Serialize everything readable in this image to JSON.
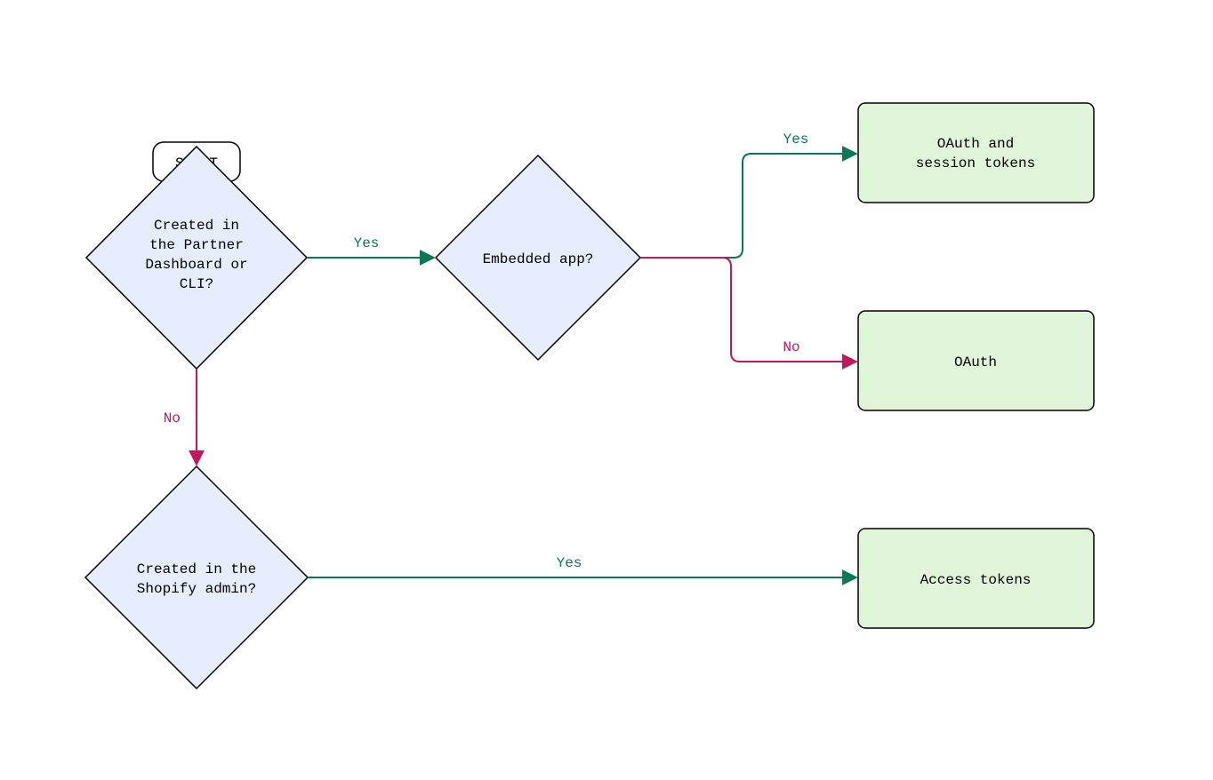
{
  "diagram": {
    "start_label": "START",
    "decision1": {
      "line1": "Created in",
      "line2": "the Partner",
      "line3": "Dashboard or",
      "line4": "CLI?"
    },
    "decision2": "Embedded app?",
    "decision3": {
      "line1": "Created in the",
      "line2": "Shopify admin?"
    },
    "outcome1": {
      "line1": "OAuth and",
      "line2": "session tokens"
    },
    "outcome2": "OAuth",
    "outcome3": "Access tokens",
    "labels": {
      "yes": "Yes",
      "no": "No"
    }
  },
  "colors": {
    "diamond_fill": "#e7edfd",
    "outcome_fill": "#dff4d8",
    "yes_stroke": "#087857",
    "no_stroke": "#c2185b",
    "border": "#000000"
  }
}
